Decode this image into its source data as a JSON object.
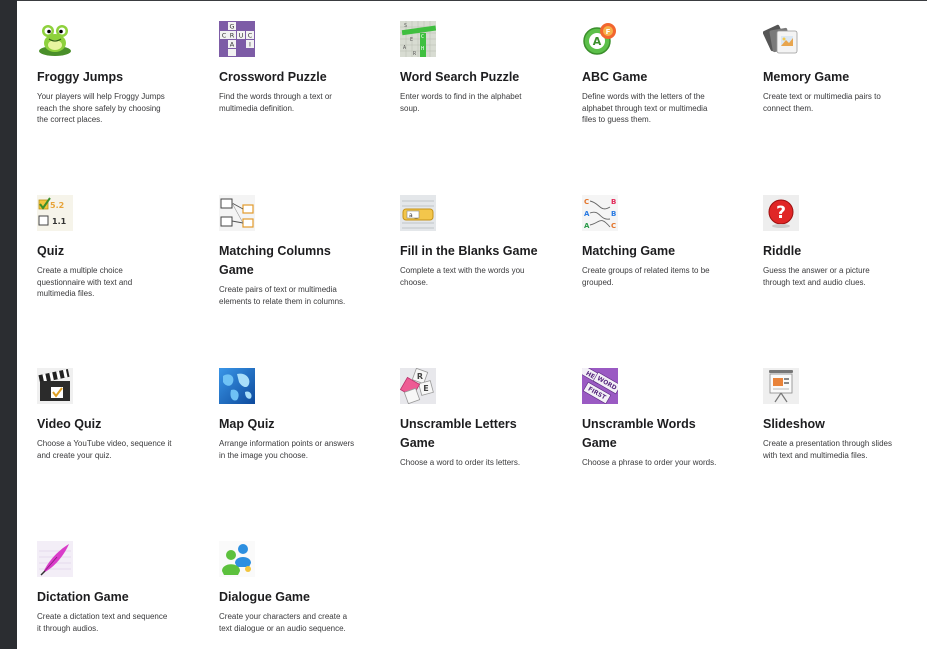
{
  "games": [
    {
      "title": "Froggy Jumps",
      "desc": "Your players will help Froggy Jumps reach the shore safely by choosing the correct places.",
      "icon": "frog-icon"
    },
    {
      "title": "Crossword Puzzle",
      "desc": "Find the words through a text or multimedia definition.",
      "icon": "crossword-icon"
    },
    {
      "title": "Word Search Puzzle",
      "desc": "Enter words to find in the alphabet soup.",
      "icon": "word-search-icon"
    },
    {
      "title": "ABC Game",
      "desc": "Define words with the letters of the alphabet through text or multimedia files to guess them.",
      "icon": "abc-icon"
    },
    {
      "title": "Memory Game",
      "desc": "Create text or multimedia pairs to connect them.",
      "icon": "memory-cards-icon"
    },
    {
      "title": "Quiz",
      "desc": "Create a multiple choice questionnaire with text and multimedia files.",
      "icon": "quiz-checkbox-icon"
    },
    {
      "title": "Matching Columns Game",
      "desc": "Create pairs of text or multimedia elements to relate them in columns.",
      "icon": "matching-columns-icon"
    },
    {
      "title": "Fill in the Blanks Game",
      "desc": "Complete a text with the words you choose.",
      "icon": "fill-blanks-icon"
    },
    {
      "title": "Matching Game",
      "desc": "Create groups of related items to be grouped.",
      "icon": "matching-letters-icon"
    },
    {
      "title": "Riddle",
      "desc": "Guess the answer or a picture through text and audio clues.",
      "icon": "question-mark-icon"
    },
    {
      "title": "Video Quiz",
      "desc": "Choose a YouTube video, sequence it and create your quiz.",
      "icon": "clapperboard-icon"
    },
    {
      "title": "Map Quiz",
      "desc": "Arrange information points or answers in the image you choose.",
      "icon": "world-map-icon"
    },
    {
      "title": "Unscramble Letters Game",
      "desc": "Choose a word to order its letters.",
      "icon": "letter-tiles-icon"
    },
    {
      "title": "Unscramble Words Game",
      "desc": "Choose a phrase to order your words.",
      "icon": "word-tiles-icon"
    },
    {
      "title": "Slideshow",
      "desc": "Create a presentation through slides with text and multimedia files.",
      "icon": "presentation-icon"
    },
    {
      "title": "Dictation Game",
      "desc": "Create a dictation text and sequence it through audios.",
      "icon": "quill-pen-icon"
    },
    {
      "title": "Dialogue Game",
      "desc": "Create your characters and create a text dialogue or an audio sequence.",
      "icon": "characters-icon"
    }
  ],
  "icon_letters": {
    "crossword": [
      "G",
      "C",
      "R",
      "U",
      "C",
      "A",
      "I"
    ],
    "abc": [
      "A",
      "F"
    ],
    "matching": [
      "C",
      "A",
      "A",
      "B",
      "B",
      "C"
    ],
    "word_tiles": [
      "HE",
      "WORD",
      "FIRST"
    ],
    "letters": [
      "R",
      "E"
    ],
    "quiz_numbers": [
      "5.2",
      "1.1"
    ],
    "riddle": "?",
    "word_search": [
      "S",
      "E",
      "A",
      "R",
      "C",
      "H"
    ],
    "fill_blank": "a _"
  }
}
